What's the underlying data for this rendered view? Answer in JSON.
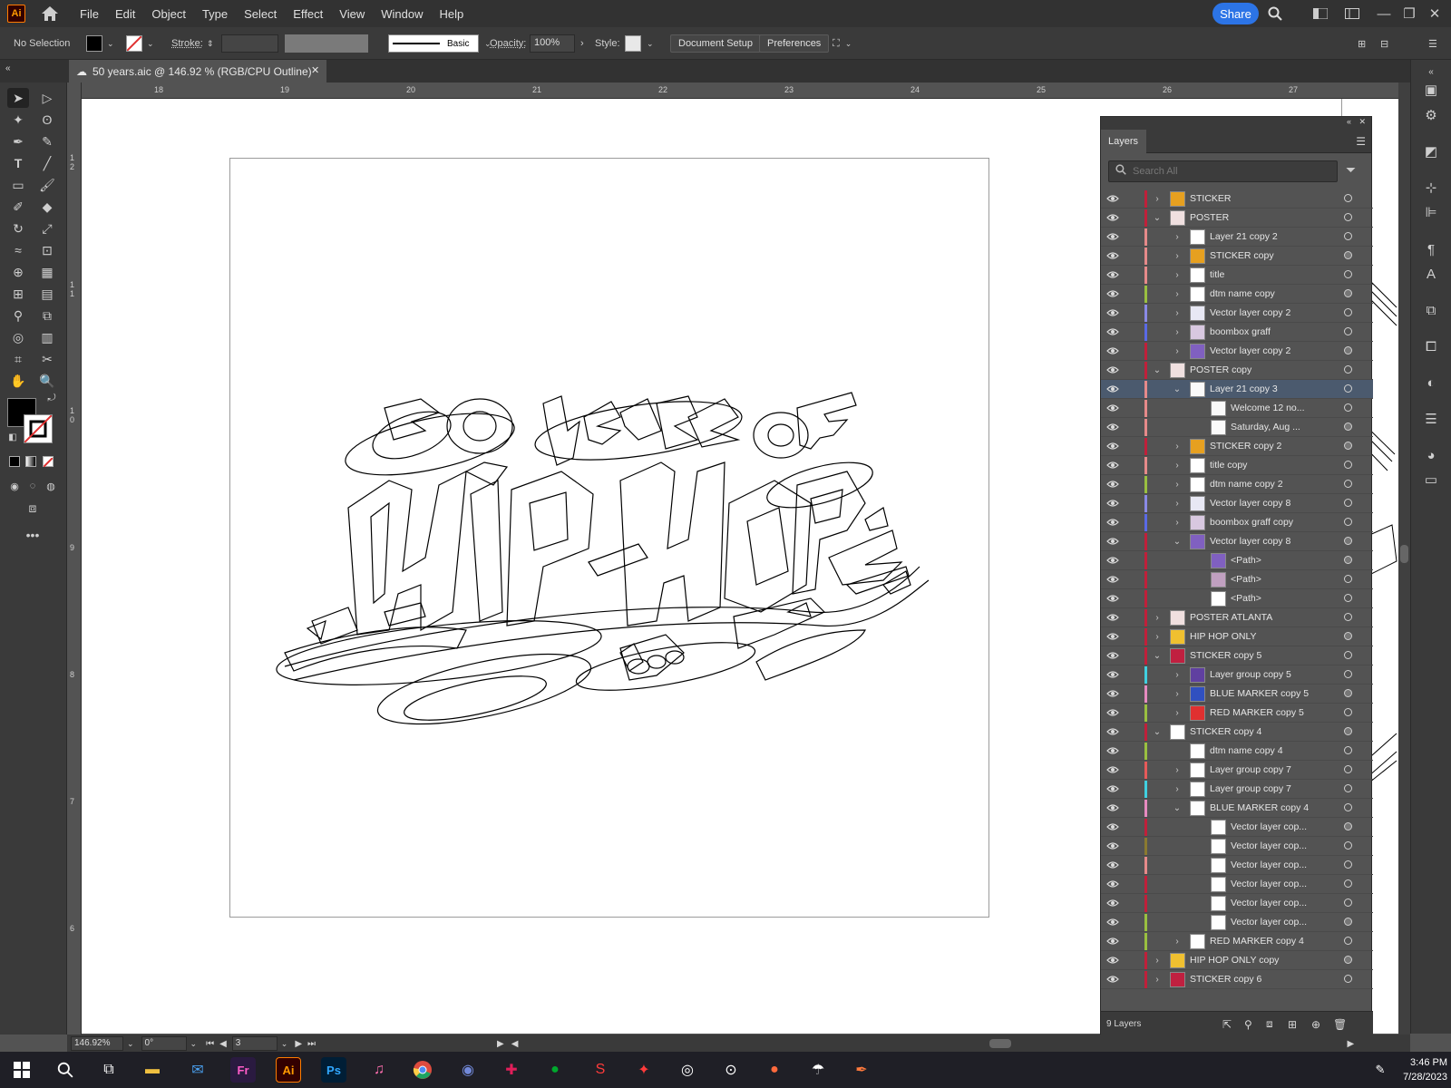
{
  "app": {
    "logo": "Ai"
  },
  "menu": [
    "File",
    "Edit",
    "Object",
    "Type",
    "Select",
    "Effect",
    "View",
    "Window",
    "Help"
  ],
  "header": {
    "share_label": "Share"
  },
  "control_bar": {
    "selection": "No Selection",
    "stroke_label": "Stroke:",
    "brush_label": "Basic",
    "opacity_label": "Opacity:",
    "opacity_value": "100%",
    "style_label": "Style:",
    "doc_setup": "Document Setup",
    "preferences": "Preferences"
  },
  "document_tab": {
    "title": "50 years.aic @ 146.92 % (RGB/CPU Outline)"
  },
  "rulers": {
    "top": [
      "18",
      "19",
      "20",
      "21",
      "22",
      "23",
      "24",
      "25",
      "26",
      "27"
    ],
    "left": [
      "1\n2",
      "1\n1",
      "1\n0",
      "9",
      "8",
      "7",
      "6"
    ]
  },
  "layers_panel": {
    "tab": "Layers",
    "search_placeholder": "Search All",
    "footer_count": "9 Layers",
    "rows": [
      {
        "name": "STICKER",
        "depth": 0,
        "chev": "right",
        "color": "#c0203a",
        "thumb": "sticker"
      },
      {
        "name": "POSTER",
        "depth": 0,
        "chev": "down",
        "color": "#c0203a",
        "thumb": "poster"
      },
      {
        "name": "Layer 21 copy 2",
        "depth": 1,
        "chev": "right",
        "color": "#e68a8a",
        "thumb": "blank"
      },
      {
        "name": "STICKER copy",
        "depth": 1,
        "chev": "right",
        "color": "#e68a8a",
        "thumb": "sticker"
      },
      {
        "name": "title",
        "depth": 1,
        "chev": "right",
        "color": "#e68a8a",
        "thumb": "blank"
      },
      {
        "name": "dtm name copy",
        "depth": 1,
        "chev": "right",
        "color": "#9ac040",
        "thumb": "blank"
      },
      {
        "name": "Vector layer copy 2",
        "depth": 1,
        "chev": "right",
        "color": "#8a8ae6",
        "thumb": "lines"
      },
      {
        "name": "boombox graff",
        "depth": 1,
        "chev": "right",
        "color": "#5a6ae6",
        "thumb": "boom"
      },
      {
        "name": "Vector layer copy 2",
        "depth": 1,
        "chev": "right",
        "color": "#c0203a",
        "thumb": "purple"
      },
      {
        "name": "POSTER copy",
        "depth": 0,
        "chev": "down",
        "color": "#c0203a",
        "thumb": "poster"
      },
      {
        "name": "Layer 21 copy 3",
        "depth": 1,
        "chev": "down",
        "color": "#e68a8a",
        "thumb": "text",
        "selected": true
      },
      {
        "name": "Welcome 12 no...",
        "depth": 2,
        "chev": "",
        "color": "#e68a8a",
        "thumb": "text"
      },
      {
        "name": "Saturday, Aug ...",
        "depth": 2,
        "chev": "",
        "color": "#e68a8a",
        "thumb": "text"
      },
      {
        "name": "STICKER copy 2",
        "depth": 1,
        "chev": "right",
        "color": "#c0203a",
        "thumb": "sticker"
      },
      {
        "name": "title copy",
        "depth": 1,
        "chev": "right",
        "color": "#e68a8a",
        "thumb": "blank"
      },
      {
        "name": "dtm name copy 2",
        "depth": 1,
        "chev": "right",
        "color": "#9ac040",
        "thumb": "blank"
      },
      {
        "name": "Vector layer copy 8",
        "depth": 1,
        "chev": "right",
        "color": "#8a8ae6",
        "thumb": "lines"
      },
      {
        "name": "boombox graff copy",
        "depth": 1,
        "chev": "right",
        "color": "#5a6ae6",
        "thumb": "boom"
      },
      {
        "name": "Vector layer copy 8",
        "depth": 1,
        "chev": "down",
        "color": "#c0203a",
        "thumb": "purple"
      },
      {
        "name": "<Path>",
        "depth": 2,
        "chev": "",
        "color": "#c0203a",
        "thumb": "purple"
      },
      {
        "name": "<Path>",
        "depth": 2,
        "chev": "",
        "color": "#c0203a",
        "thumb": "mauve"
      },
      {
        "name": "<Path>",
        "depth": 2,
        "chev": "",
        "color": "#c0203a",
        "thumb": "blank"
      },
      {
        "name": "POSTER ATLANTA",
        "depth": 0,
        "chev": "right",
        "color": "#c0203a",
        "thumb": "poster"
      },
      {
        "name": "HIP HOP ONLY",
        "depth": 0,
        "chev": "right",
        "color": "#c0203a",
        "thumb": "hiphop"
      },
      {
        "name": "STICKER copy 5",
        "depth": 0,
        "chev": "down",
        "color": "#c0203a",
        "thumb": "cross"
      },
      {
        "name": "Layer group copy 5",
        "depth": 1,
        "chev": "right",
        "color": "#40d0e0",
        "thumb": "figure"
      },
      {
        "name": "BLUE MARKER copy 5",
        "depth": 1,
        "chev": "right",
        "color": "#e68ac0",
        "thumb": "marker"
      },
      {
        "name": "RED MARKER copy 5",
        "depth": 1,
        "chev": "right",
        "color": "#9ac040",
        "thumb": "redmarker"
      },
      {
        "name": "STICKER copy 4",
        "depth": 0,
        "chev": "down",
        "color": "#c0203a",
        "thumb": "blank"
      },
      {
        "name": "dtm name copy 4",
        "depth": 1,
        "chev": "",
        "color": "#9ac040",
        "thumb": "blank"
      },
      {
        "name": "Layer group copy 7",
        "depth": 1,
        "chev": "right",
        "color": "#e65a5a",
        "thumb": "blank"
      },
      {
        "name": "Layer group copy 7",
        "depth": 1,
        "chev": "right",
        "color": "#40d0e0",
        "thumb": "blank"
      },
      {
        "name": "BLUE MARKER copy 4",
        "depth": 1,
        "chev": "down",
        "color": "#e68ac0",
        "thumb": "blank"
      },
      {
        "name": "Vector layer cop...",
        "depth": 2,
        "chev": "",
        "color": "#c0203a",
        "thumb": "blank"
      },
      {
        "name": "Vector layer cop...",
        "depth": 2,
        "chev": "",
        "color": "#8a7a30",
        "thumb": "blank"
      },
      {
        "name": "Vector layer cop...",
        "depth": 2,
        "chev": "",
        "color": "#e68a8a",
        "thumb": "blank"
      },
      {
        "name": "Vector layer cop...",
        "depth": 2,
        "chev": "",
        "color": "#c0203a",
        "thumb": "blank"
      },
      {
        "name": "Vector layer cop...",
        "depth": 2,
        "chev": "",
        "color": "#c0203a",
        "thumb": "blank"
      },
      {
        "name": "Vector layer cop...",
        "depth": 2,
        "chev": "",
        "color": "#9ac040",
        "thumb": "blank"
      },
      {
        "name": "RED MARKER copy 4",
        "depth": 1,
        "chev": "right",
        "color": "#9ac040",
        "thumb": "blank"
      },
      {
        "name": "HIP HOP ONLY copy",
        "depth": 0,
        "chev": "right",
        "color": "#c0203a",
        "thumb": "hiphop"
      },
      {
        "name": "STICKER copy 6",
        "depth": 0,
        "chev": "right",
        "color": "#c0203a",
        "thumb": "cross"
      }
    ]
  },
  "status_bar": {
    "zoom": "146.92%",
    "rotation": "0°",
    "artboard": "3"
  },
  "taskbar": {
    "time": "3:46 PM",
    "date": "7/28/2023"
  }
}
